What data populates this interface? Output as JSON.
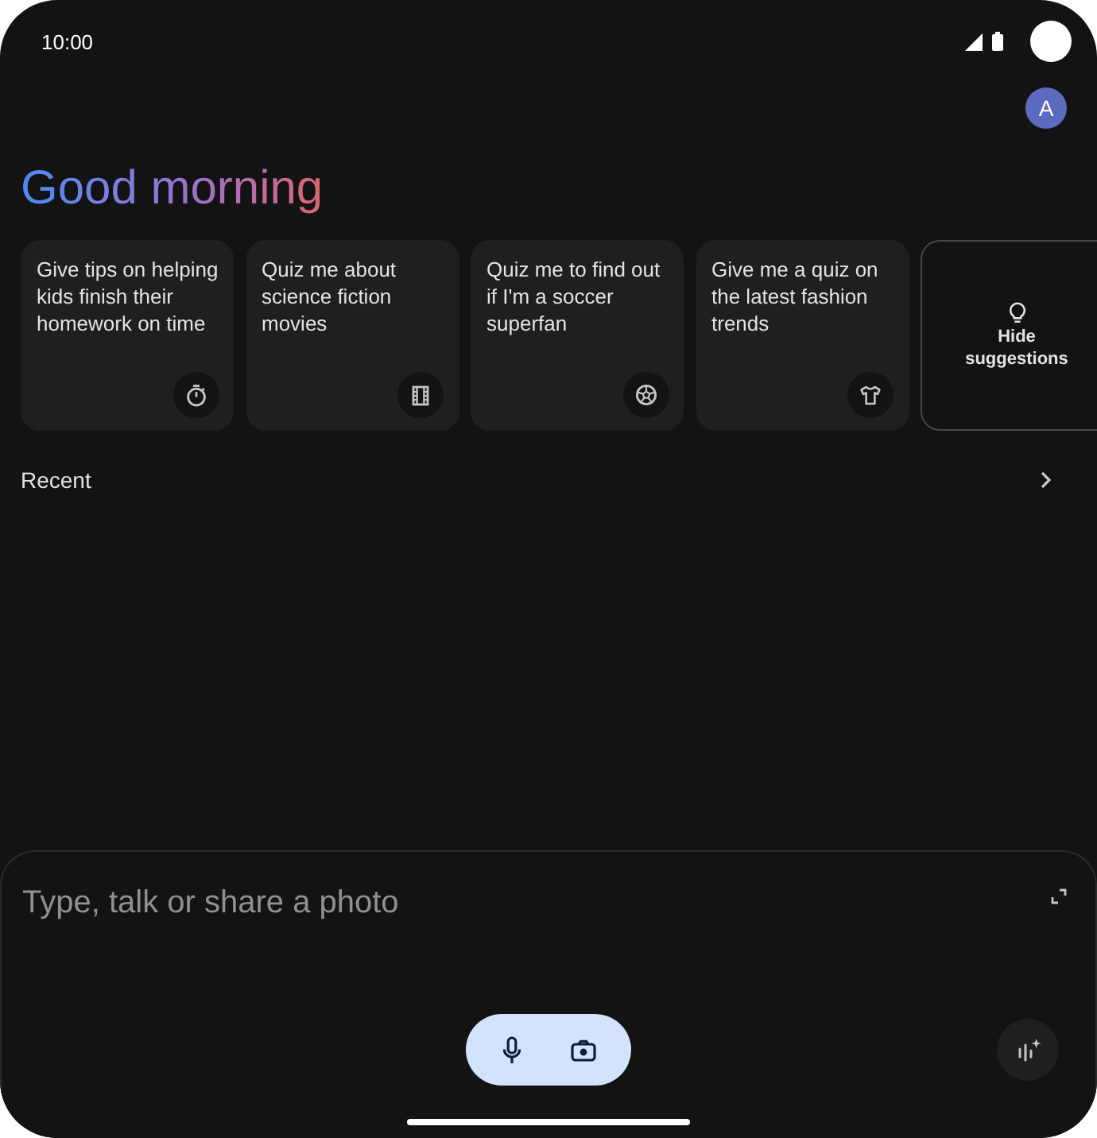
{
  "status_bar": {
    "time": "10:00"
  },
  "account": {
    "initial": "A"
  },
  "greeting": "Good morning",
  "suggestions": [
    {
      "text": "Give tips on helping kids finish their homework on time"
    },
    {
      "text": "Quiz me about science fiction movies"
    },
    {
      "text": "Quiz me to find out if I'm a soccer superfan"
    },
    {
      "text": "Give me a quiz on the latest fashion trends"
    }
  ],
  "hide_suggestions": {
    "label": "Hide suggestions"
  },
  "recent": {
    "title": "Recent"
  },
  "composer": {
    "placeholder": "Type, talk or share a photo"
  }
}
